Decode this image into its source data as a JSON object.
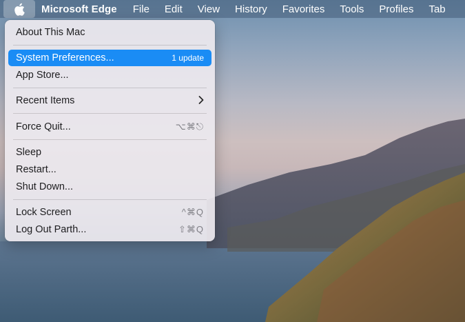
{
  "menubar": {
    "app_name": "Microsoft Edge",
    "items": [
      "File",
      "Edit",
      "View",
      "History",
      "Favorites",
      "Tools",
      "Profiles",
      "Tab"
    ]
  },
  "apple_menu": {
    "about": "About This Mac",
    "system_preferences": "System Preferences...",
    "system_preferences_badge": "1 update",
    "app_store": "App Store...",
    "recent_items": "Recent Items",
    "force_quit": "Force Quit...",
    "force_quit_shortcut": "⌥⌘⎋",
    "sleep": "Sleep",
    "restart": "Restart...",
    "shut_down": "Shut Down...",
    "lock_screen": "Lock Screen",
    "lock_screen_shortcut": "^⌘Q",
    "log_out": "Log Out Parth...",
    "log_out_shortcut": "⇧⌘Q"
  },
  "colors": {
    "highlight": "#1a8cf5"
  }
}
